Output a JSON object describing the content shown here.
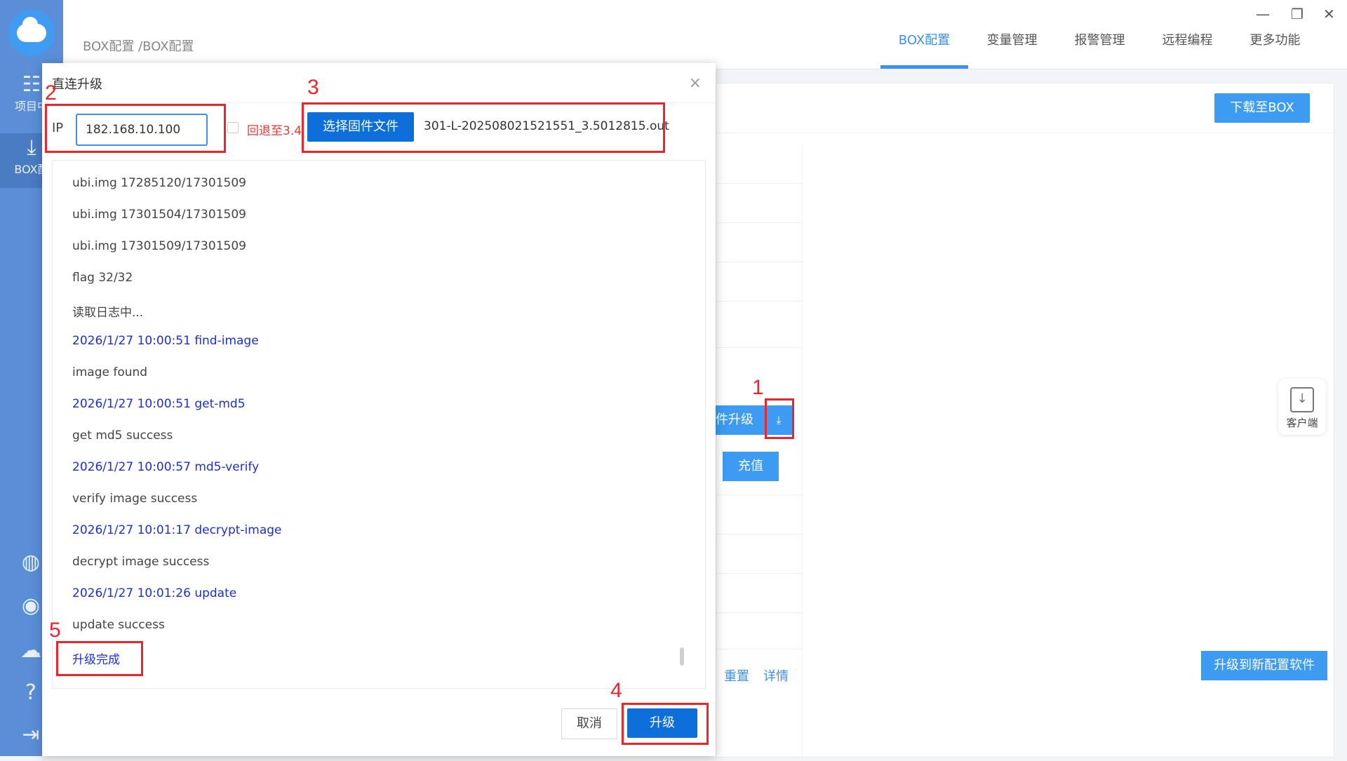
{
  "breadcrumb": "BOX配置 /BOX配置",
  "tabs": [
    {
      "label": "BOX配置",
      "active": true
    },
    {
      "label": "变量管理"
    },
    {
      "label": "报警管理"
    },
    {
      "label": "远程编程"
    },
    {
      "label": "更多功能"
    }
  ],
  "window_controls": {
    "minimize": "—",
    "restore": "❐",
    "close": "✕"
  },
  "sidebar": {
    "items": [
      {
        "label": "项目中",
        "icon": "list-icon"
      },
      {
        "label": "BOX配",
        "icon": "download-icon",
        "active": true
      }
    ],
    "bottom_icons": [
      "globe-icon",
      "user-icon",
      "cloud-upload-icon",
      "help-icon",
      "logout-icon"
    ]
  },
  "panel": {
    "download_button": "下载至BOX",
    "split_button": "件升级",
    "recharge_button": "充值",
    "links": [
      "重置",
      "详情"
    ],
    "upgrade_new_button": "升级到新配置软件",
    "client_label": "客户端"
  },
  "dialog": {
    "title": "直连升级",
    "ip_label": "IP",
    "ip_value": "182.168.10.100",
    "rollback_label": "回退至3.4",
    "choose_button": "选择固件文件",
    "file_name": "301-L-202508021521551_3.5012815.out",
    "cancel_button": "取消",
    "upgrade_button": "升级",
    "log": [
      {
        "text": "ubi.img 17285120/17301509",
        "kind": "normal"
      },
      {
        "text": "ubi.img 17301504/17301509",
        "kind": "normal"
      },
      {
        "text": "ubi.img 17301509/17301509",
        "kind": "normal"
      },
      {
        "text": "flag 32/32",
        "kind": "normal"
      },
      {
        "text": "读取日志中...",
        "kind": "normal"
      },
      {
        "text": "2026/1/27 10:00:51 find-image",
        "kind": "ts"
      },
      {
        "text": "image found",
        "kind": "normal"
      },
      {
        "text": "2026/1/27 10:00:51 get-md5",
        "kind": "ts"
      },
      {
        "text": "get md5 success",
        "kind": "normal"
      },
      {
        "text": "2026/1/27 10:00:57 md5-verify",
        "kind": "ts"
      },
      {
        "text": "verify image success",
        "kind": "normal"
      },
      {
        "text": "2026/1/27 10:01:17 decrypt-image",
        "kind": "ts"
      },
      {
        "text": "decrypt image success",
        "kind": "normal"
      },
      {
        "text": "2026/1/27 10:01:26 update",
        "kind": "ts"
      },
      {
        "text": "update success",
        "kind": "normal"
      },
      {
        "text": "升级完成",
        "kind": "ts"
      }
    ]
  },
  "annotations": [
    "1",
    "2",
    "3",
    "4",
    "5"
  ]
}
